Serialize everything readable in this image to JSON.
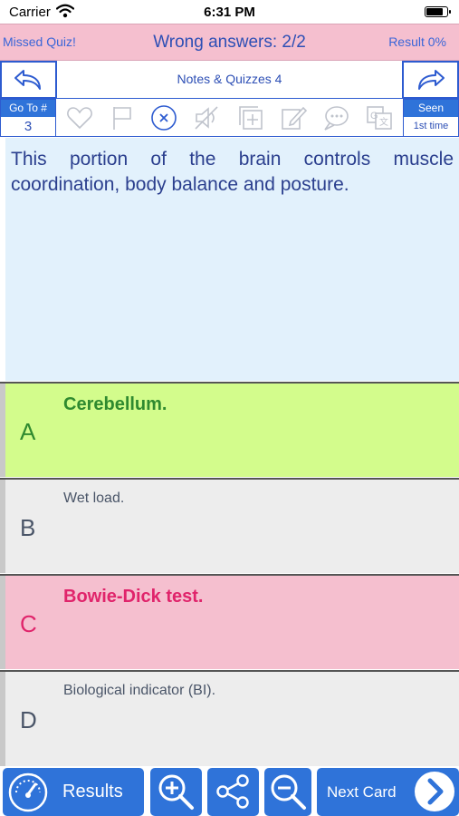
{
  "status": {
    "carrier": "Carrier",
    "time": "6:31 PM",
    "battery_level": 0.9
  },
  "header": {
    "missed": "Missed Quiz!",
    "wrong": "Wrong answers: 2/2",
    "result": "Result 0%"
  },
  "nav": {
    "title": "Notes & Quizzes 4"
  },
  "goto": {
    "label": "Go To #",
    "value": "3"
  },
  "seen": {
    "label": "Seen",
    "value": "1st time"
  },
  "question": {
    "text": "This portion of the brain controls muscle coordination, body balance and posture."
  },
  "answers": [
    {
      "letter": "A",
      "text": "Cerebellum.",
      "state": "correct"
    },
    {
      "letter": "B",
      "text": "Wet load.",
      "state": "neutral"
    },
    {
      "letter": "C",
      "text": "Bowie-Dick test.",
      "state": "wrong"
    },
    {
      "letter": "D",
      "text": "Biological indicator (BI).",
      "state": "neutral"
    }
  ],
  "bottom": {
    "results": "Results",
    "next": "Next Card"
  },
  "colors": {
    "accent": "#2f73d9",
    "header_pink": "#f5bfcf",
    "correct_bg": "#d3fc8c",
    "wrong_bg": "#f5bfcf",
    "neutral_bg": "#ededed",
    "question_bg": "#e2f1fc"
  },
  "icons": [
    "undo-arrow-icon",
    "redo-arrow-icon",
    "heart-icon",
    "flag-icon",
    "cancel-circle-icon",
    "mute-icon",
    "add-note-icon",
    "edit-icon",
    "chat-icon",
    "translate-icon",
    "speedometer-icon",
    "zoom-in-icon",
    "share-icon",
    "zoom-out-icon",
    "chevron-right-icon"
  ]
}
